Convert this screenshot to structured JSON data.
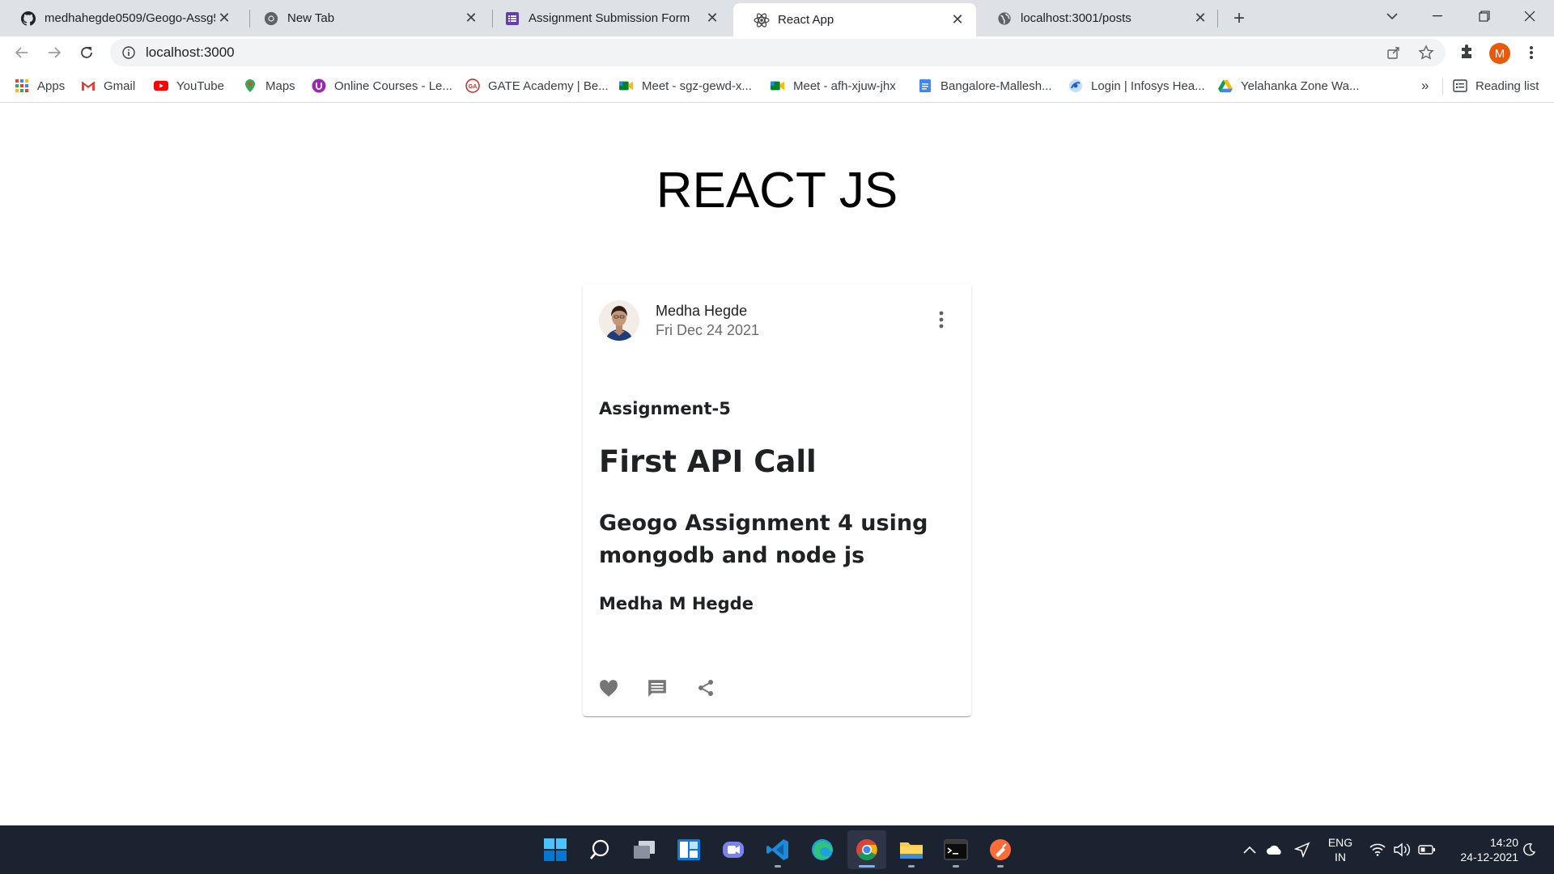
{
  "browser": {
    "tabs": [
      {
        "title": "medhahegde0509/Geogo-Assg5",
        "icon": "github-icon"
      },
      {
        "title": "New Tab",
        "icon": "chrome-icon"
      },
      {
        "title": "Assignment Submission Form",
        "icon": "forms-icon"
      },
      {
        "title": "React App",
        "icon": "react-icon",
        "active": true
      },
      {
        "title": "localhost:3001/posts",
        "icon": "globe-icon"
      }
    ],
    "url": "localhost:3000",
    "profile_initial": "M",
    "profile_color": "#e8590c"
  },
  "bookmarks": {
    "items": [
      {
        "label": "Apps",
        "icon": "apps-grid-icon"
      },
      {
        "label": "Gmail",
        "icon": "gmail-icon"
      },
      {
        "label": "YouTube",
        "icon": "youtube-icon"
      },
      {
        "label": "Maps",
        "icon": "maps-icon"
      },
      {
        "label": "Online Courses - Le...",
        "icon": "courses-icon"
      },
      {
        "label": "GATE Academy | Be...",
        "icon": "gate-icon"
      },
      {
        "label": "Meet - sgz-gewd-x...",
        "icon": "meet-icon"
      },
      {
        "label": "Meet - afh-xjuw-jhx",
        "icon": "meet-icon"
      },
      {
        "label": "Bangalore-Mallesh...",
        "icon": "docs-icon"
      },
      {
        "label": "Login | Infosys Hea...",
        "icon": "infosys-icon"
      },
      {
        "label": "Yelahanka Zone Wa...",
        "icon": "drive-icon"
      }
    ],
    "overflow": "»",
    "reading_list": "Reading list"
  },
  "page": {
    "title": "REACT JS",
    "card": {
      "author_name": "Medha Hegde",
      "date": "Fri Dec 24 2021",
      "assignment": "Assignment-5",
      "heading": "First API Call",
      "subheading": "Geogo Assignment 4 using mongodb and node js",
      "byline": "Medha M Hegde",
      "actions": [
        "favorite-icon",
        "comment-icon",
        "share-icon"
      ]
    }
  },
  "taskbar": {
    "language": "ENG",
    "region": "IN",
    "time": "14:20",
    "date": "24-12-2021"
  }
}
